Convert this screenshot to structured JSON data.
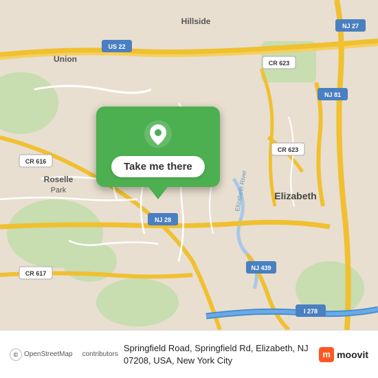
{
  "map": {
    "alt": "Map of Springfield Road, Elizabeth, NJ area"
  },
  "callout": {
    "button_label": "Take me there"
  },
  "bottom_bar": {
    "osm_label": "©",
    "osm_name": "OpenStreetMap",
    "contributors": "contributors",
    "address": "Springfield Road, Springfield Rd, Elizabeth, NJ 07208, USA, New York City"
  },
  "moovit": {
    "initial": "m",
    "name": "moovit"
  }
}
